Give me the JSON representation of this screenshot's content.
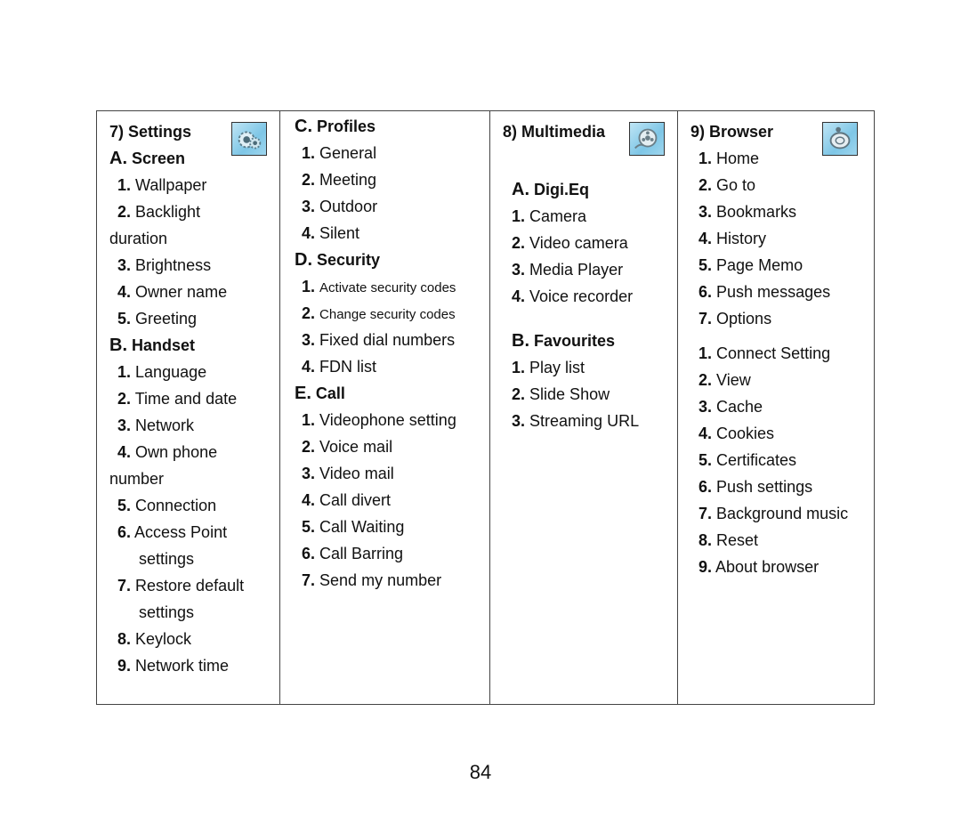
{
  "page_number": "84",
  "columns": [
    {
      "header": "7) Settings",
      "icon": "settings-gears-icon",
      "lines": [
        {
          "type": "section",
          "letter": "A.",
          "text": "Screen"
        },
        {
          "type": "item",
          "num": "1.",
          "text": "Wallpaper"
        },
        {
          "type": "item",
          "num": "2.",
          "text": "Backlight"
        },
        {
          "type": "cont",
          "text": "duration"
        },
        {
          "type": "item",
          "num": "3.",
          "text": "Brightness"
        },
        {
          "type": "item",
          "num": "4.",
          "text": "Owner name"
        },
        {
          "type": "item",
          "num": "5.",
          "text": "Greeting"
        },
        {
          "type": "section",
          "letter": "B.",
          "text": "Handset"
        },
        {
          "type": "item",
          "num": "1.",
          "text": "Language"
        },
        {
          "type": "item",
          "num": "2.",
          "text": "Time and date"
        },
        {
          "type": "item",
          "num": "3.",
          "text": "Network"
        },
        {
          "type": "item",
          "num": "4.",
          "text": "Own phone"
        },
        {
          "type": "cont",
          "text": "number"
        },
        {
          "type": "item",
          "num": "5.",
          "text": "Connection"
        },
        {
          "type": "item",
          "num": "6.",
          "text": "Access Point"
        },
        {
          "type": "cont-indent",
          "text": "settings"
        },
        {
          "type": "item",
          "num": "7.",
          "text": "Restore default"
        },
        {
          "type": "cont-indent",
          "text": "settings"
        },
        {
          "type": "item",
          "num": "8.",
          "text": "Keylock"
        },
        {
          "type": "item",
          "num": "9.",
          "text": "Network time"
        }
      ]
    },
    {
      "lines": [
        {
          "type": "section",
          "letter": "C.",
          "text": "Profiles"
        },
        {
          "type": "item",
          "num": "1.",
          "text": "General"
        },
        {
          "type": "item",
          "num": "2.",
          "text": "Meeting"
        },
        {
          "type": "item",
          "num": "3.",
          "text": "Outdoor"
        },
        {
          "type": "item",
          "num": "4.",
          "text": "Silent"
        },
        {
          "type": "section",
          "letter": "D.",
          "text": "Security"
        },
        {
          "type": "item-small",
          "num": "1.",
          "text": "Activate security codes"
        },
        {
          "type": "item-small",
          "num": "2.",
          "text": "Change security codes"
        },
        {
          "type": "item",
          "num": "3.",
          "text": "Fixed dial numbers"
        },
        {
          "type": "item",
          "num": "4.",
          "text": "FDN list"
        },
        {
          "type": "section",
          "letter": "E.",
          "text": "Call"
        },
        {
          "type": "item",
          "num": "1.",
          "text": "Videophone setting"
        },
        {
          "type": "item",
          "num": "2.",
          "text": "Voice mail"
        },
        {
          "type": "item",
          "num": "3.",
          "text": "Video mail"
        },
        {
          "type": "item",
          "num": "4.",
          "text": "Call divert"
        },
        {
          "type": "item",
          "num": "5.",
          "text": "Call Waiting"
        },
        {
          "type": "item",
          "num": "6.",
          "text": "Call Barring"
        },
        {
          "type": "item",
          "num": "7.",
          "text": "Send my number"
        }
      ]
    },
    {
      "header": "8) Multimedia",
      "icon": "multimedia-film-reel-icon",
      "lines": [
        {
          "type": "section",
          "letter": "A.",
          "text": "Digi.Eq"
        },
        {
          "type": "item",
          "num": "1.",
          "text": "Camera"
        },
        {
          "type": "item",
          "num": "2.",
          "text": "Video camera"
        },
        {
          "type": "item",
          "num": "3.",
          "text": "Media Player"
        },
        {
          "type": "item",
          "num": "4.",
          "text": "Voice recorder"
        },
        {
          "type": "section",
          "letter": "B.",
          "text": "Favourites"
        },
        {
          "type": "item",
          "num": "1.",
          "text": "Play list"
        },
        {
          "type": "item",
          "num": "2.",
          "text": "Slide Show"
        },
        {
          "type": "item",
          "num": "3.",
          "text": "Streaming URL"
        }
      ]
    },
    {
      "header": "9) Browser",
      "icon": "browser-globe-icon",
      "lines": [
        {
          "type": "item",
          "num": "1.",
          "text": "Home"
        },
        {
          "type": "item",
          "num": "2.",
          "text": "Go to"
        },
        {
          "type": "item",
          "num": "3.",
          "text": "Bookmarks"
        },
        {
          "type": "item",
          "num": "4.",
          "text": "History"
        },
        {
          "type": "item",
          "num": "5.",
          "text": "Page Memo"
        },
        {
          "type": "item",
          "num": "6.",
          "text": "Push messages"
        },
        {
          "type": "item",
          "num": "7.",
          "text": "Options"
        },
        {
          "type": "item",
          "num": "1.",
          "text": "Connect Setting"
        },
        {
          "type": "item",
          "num": "2.",
          "text": "View"
        },
        {
          "type": "item",
          "num": "3.",
          "text": "Cache"
        },
        {
          "type": "item",
          "num": "4.",
          "text": "Cookies"
        },
        {
          "type": "item",
          "num": "5.",
          "text": "Certificates"
        },
        {
          "type": "item",
          "num": "6.",
          "text": "Push settings"
        },
        {
          "type": "item",
          "num": "7.",
          "text": "Background music"
        },
        {
          "type": "item",
          "num": "8.",
          "text": "Reset"
        },
        {
          "type": "item",
          "num": "9.",
          "text": "About browser"
        }
      ]
    }
  ]
}
